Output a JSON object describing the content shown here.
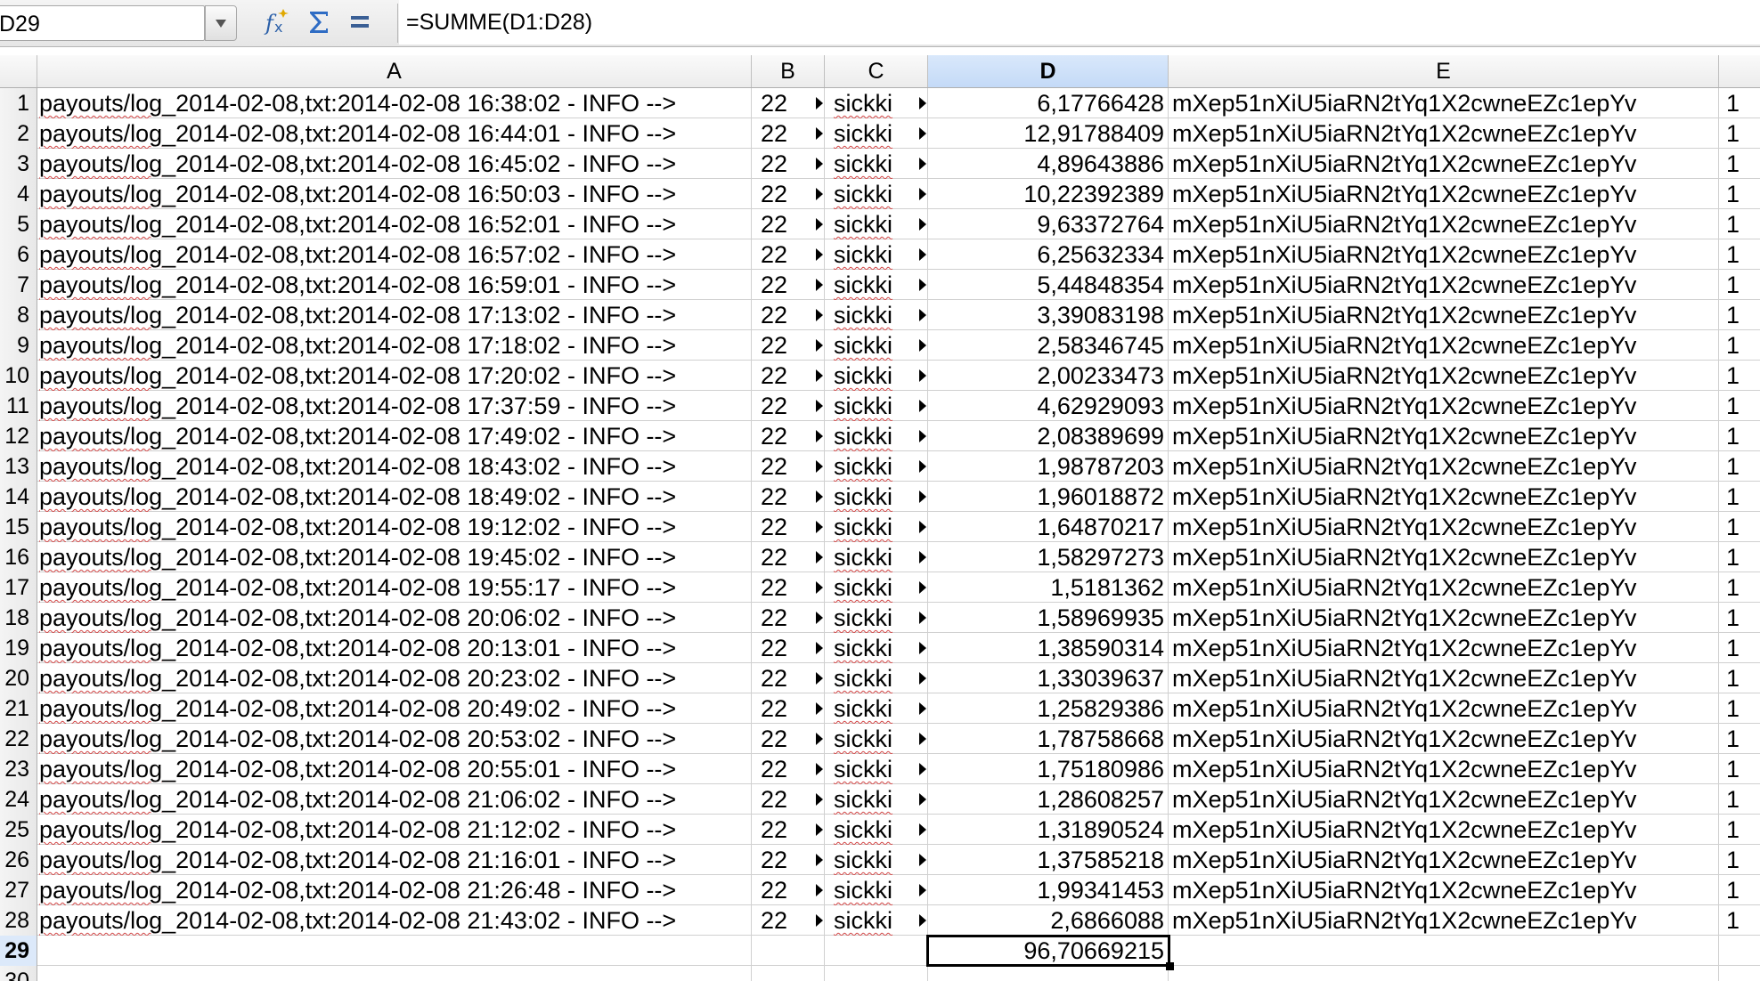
{
  "formula_bar": {
    "name_box": "D29",
    "icons": [
      "function-wizard-icon",
      "sum-icon",
      "equals-icon"
    ],
    "formula": "=SUMME(D1:D28)"
  },
  "columns": [
    "A",
    "B",
    "C",
    "D",
    "E"
  ],
  "selected_column": "D",
  "rows": [
    {
      "num": "1",
      "a_prefix": "payouts/log",
      "a_rest": "_2014-02-08,txt:2014-02-08 16:38:02 - INFO -->",
      "b": "22",
      "c": "sickki",
      "d": "6,17766428",
      "e": "mXep51nXiU5iaRN2tYq1X2cwneEZc1epYv",
      "f": "1"
    },
    {
      "num": "2",
      "a_prefix": "payouts/log",
      "a_rest": "_2014-02-08,txt:2014-02-08 16:44:01 - INFO -->",
      "b": "22",
      "c": "sickki",
      "d": "12,91788409",
      "e": "mXep51nXiU5iaRN2tYq1X2cwneEZc1epYv",
      "f": "1"
    },
    {
      "num": "3",
      "a_prefix": "payouts/log",
      "a_rest": "_2014-02-08,txt:2014-02-08 16:45:02 - INFO -->",
      "b": "22",
      "c": "sickki",
      "d": "4,89643886",
      "e": "mXep51nXiU5iaRN2tYq1X2cwneEZc1epYv",
      "f": "1"
    },
    {
      "num": "4",
      "a_prefix": "payouts/log",
      "a_rest": "_2014-02-08,txt:2014-02-08 16:50:03 - INFO -->",
      "b": "22",
      "c": "sickki",
      "d": "10,22392389",
      "e": "mXep51nXiU5iaRN2tYq1X2cwneEZc1epYv",
      "f": "1"
    },
    {
      "num": "5",
      "a_prefix": "payouts/log",
      "a_rest": "_2014-02-08,txt:2014-02-08 16:52:01 - INFO -->",
      "b": "22",
      "c": "sickki",
      "d": "9,63372764",
      "e": "mXep51nXiU5iaRN2tYq1X2cwneEZc1epYv",
      "f": "1"
    },
    {
      "num": "6",
      "a_prefix": "payouts/log",
      "a_rest": "_2014-02-08,txt:2014-02-08 16:57:02 - INFO -->",
      "b": "22",
      "c": "sickki",
      "d": "6,25632334",
      "e": "mXep51nXiU5iaRN2tYq1X2cwneEZc1epYv",
      "f": "1"
    },
    {
      "num": "7",
      "a_prefix": "payouts/log",
      "a_rest": "_2014-02-08,txt:2014-02-08 16:59:01 - INFO -->",
      "b": "22",
      "c": "sickki",
      "d": "5,44848354",
      "e": "mXep51nXiU5iaRN2tYq1X2cwneEZc1epYv",
      "f": "1"
    },
    {
      "num": "8",
      "a_prefix": "payouts/log",
      "a_rest": "_2014-02-08,txt:2014-02-08 17:13:02 - INFO -->",
      "b": "22",
      "c": "sickki",
      "d": "3,39083198",
      "e": "mXep51nXiU5iaRN2tYq1X2cwneEZc1epYv",
      "f": "1"
    },
    {
      "num": "9",
      "a_prefix": "payouts/log",
      "a_rest": "_2014-02-08,txt:2014-02-08 17:18:02 - INFO -->",
      "b": "22",
      "c": "sickki",
      "d": "2,58346745",
      "e": "mXep51nXiU5iaRN2tYq1X2cwneEZc1epYv",
      "f": "1"
    },
    {
      "num": "10",
      "a_prefix": "payouts/log",
      "a_rest": "_2014-02-08,txt:2014-02-08 17:20:02 - INFO -->",
      "b": "22",
      "c": "sickki",
      "d": "2,00233473",
      "e": "mXep51nXiU5iaRN2tYq1X2cwneEZc1epYv",
      "f": "1"
    },
    {
      "num": "11",
      "a_prefix": "payouts/log",
      "a_rest": "_2014-02-08,txt:2014-02-08 17:37:59 - INFO -->",
      "b": "22",
      "c": "sickki",
      "d": "4,62929093",
      "e": "mXep51nXiU5iaRN2tYq1X2cwneEZc1epYv",
      "f": "1"
    },
    {
      "num": "12",
      "a_prefix": "payouts/log",
      "a_rest": "_2014-02-08,txt:2014-02-08 17:49:02 - INFO -->",
      "b": "22",
      "c": "sickki",
      "d": "2,08389699",
      "e": "mXep51nXiU5iaRN2tYq1X2cwneEZc1epYv",
      "f": "1"
    },
    {
      "num": "13",
      "a_prefix": "payouts/log",
      "a_rest": "_2014-02-08,txt:2014-02-08 18:43:02 - INFO -->",
      "b": "22",
      "c": "sickki",
      "d": "1,98787203",
      "e": "mXep51nXiU5iaRN2tYq1X2cwneEZc1epYv",
      "f": "1"
    },
    {
      "num": "14",
      "a_prefix": "payouts/log",
      "a_rest": "_2014-02-08,txt:2014-02-08 18:49:02 - INFO -->",
      "b": "22",
      "c": "sickki",
      "d": "1,96018872",
      "e": "mXep51nXiU5iaRN2tYq1X2cwneEZc1epYv",
      "f": "1"
    },
    {
      "num": "15",
      "a_prefix": "payouts/log",
      "a_rest": "_2014-02-08,txt:2014-02-08 19:12:02 - INFO -->",
      "b": "22",
      "c": "sickki",
      "d": "1,64870217",
      "e": "mXep51nXiU5iaRN2tYq1X2cwneEZc1epYv",
      "f": "1"
    },
    {
      "num": "16",
      "a_prefix": "payouts/log",
      "a_rest": "_2014-02-08,txt:2014-02-08 19:45:02 - INFO -->",
      "b": "22",
      "c": "sickki",
      "d": "1,58297273",
      "e": "mXep51nXiU5iaRN2tYq1X2cwneEZc1epYv",
      "f": "1"
    },
    {
      "num": "17",
      "a_prefix": "payouts/log",
      "a_rest": "_2014-02-08,txt:2014-02-08 19:55:17 - INFO -->",
      "b": "22",
      "c": "sickki",
      "d": "1,5181362",
      "e": "mXep51nXiU5iaRN2tYq1X2cwneEZc1epYv",
      "f": "1"
    },
    {
      "num": "18",
      "a_prefix": "payouts/log",
      "a_rest": "_2014-02-08,txt:2014-02-08 20:06:02 - INFO -->",
      "b": "22",
      "c": "sickki",
      "d": "1,58969935",
      "e": "mXep51nXiU5iaRN2tYq1X2cwneEZc1epYv",
      "f": "1"
    },
    {
      "num": "19",
      "a_prefix": "payouts/log",
      "a_rest": "_2014-02-08,txt:2014-02-08 20:13:01 - INFO -->",
      "b": "22",
      "c": "sickki",
      "d": "1,38590314",
      "e": "mXep51nXiU5iaRN2tYq1X2cwneEZc1epYv",
      "f": "1"
    },
    {
      "num": "20",
      "a_prefix": "payouts/log",
      "a_rest": "_2014-02-08,txt:2014-02-08 20:23:02 - INFO -->",
      "b": "22",
      "c": "sickki",
      "d": "1,33039637",
      "e": "mXep51nXiU5iaRN2tYq1X2cwneEZc1epYv",
      "f": "1"
    },
    {
      "num": "21",
      "a_prefix": "payouts/log",
      "a_rest": "_2014-02-08,txt:2014-02-08 20:49:02 - INFO -->",
      "b": "22",
      "c": "sickki",
      "d": "1,25829386",
      "e": "mXep51nXiU5iaRN2tYq1X2cwneEZc1epYv",
      "f": "1"
    },
    {
      "num": "22",
      "a_prefix": "payouts/log",
      "a_rest": "_2014-02-08,txt:2014-02-08 20:53:02 - INFO -->",
      "b": "22",
      "c": "sickki",
      "d": "1,78758668",
      "e": "mXep51nXiU5iaRN2tYq1X2cwneEZc1epYv",
      "f": "1"
    },
    {
      "num": "23",
      "a_prefix": "payouts/log",
      "a_rest": "_2014-02-08,txt:2014-02-08 20:55:01 - INFO -->",
      "b": "22",
      "c": "sickki",
      "d": "1,75180986",
      "e": "mXep51nXiU5iaRN2tYq1X2cwneEZc1epYv",
      "f": "1"
    },
    {
      "num": "24",
      "a_prefix": "payouts/log",
      "a_rest": "_2014-02-08,txt:2014-02-08 21:06:02 - INFO -->",
      "b": "22",
      "c": "sickki",
      "d": "1,28608257",
      "e": "mXep51nXiU5iaRN2tYq1X2cwneEZc1epYv",
      "f": "1"
    },
    {
      "num": "25",
      "a_prefix": "payouts/log",
      "a_rest": "_2014-02-08,txt:2014-02-08 21:12:02 - INFO -->",
      "b": "22",
      "c": "sickki",
      "d": "1,31890524",
      "e": "mXep51nXiU5iaRN2tYq1X2cwneEZc1epYv",
      "f": "1"
    },
    {
      "num": "26",
      "a_prefix": "payouts/log",
      "a_rest": "_2014-02-08,txt:2014-02-08 21:16:01 - INFO -->",
      "b": "22",
      "c": "sickki",
      "d": "1,37585218",
      "e": "mXep51nXiU5iaRN2tYq1X2cwneEZc1epYv",
      "f": "1"
    },
    {
      "num": "27",
      "a_prefix": "payouts/log",
      "a_rest": "_2014-02-08,txt:2014-02-08 21:26:48 - INFO -->",
      "b": "22",
      "c": "sickki",
      "d": "1,99341453",
      "e": "mXep51nXiU5iaRN2tYq1X2cwneEZc1epYv",
      "f": "1"
    },
    {
      "num": "28",
      "a_prefix": "payouts/log",
      "a_rest": "_2014-02-08,txt:2014-02-08 21:43:02 - INFO -->",
      "b": "22",
      "c": "sickki",
      "d": "2,6866088",
      "e": "mXep51nXiU5iaRN2tYq1X2cwneEZc1epYv",
      "f": "1"
    }
  ],
  "sum_row": {
    "num": "29",
    "d": "96,70669215"
  },
  "extra_row": {
    "num": "30"
  },
  "colors": {
    "selected_header": "#c4daf7",
    "spell_underline": "#d24545",
    "active_border": "#000000"
  }
}
